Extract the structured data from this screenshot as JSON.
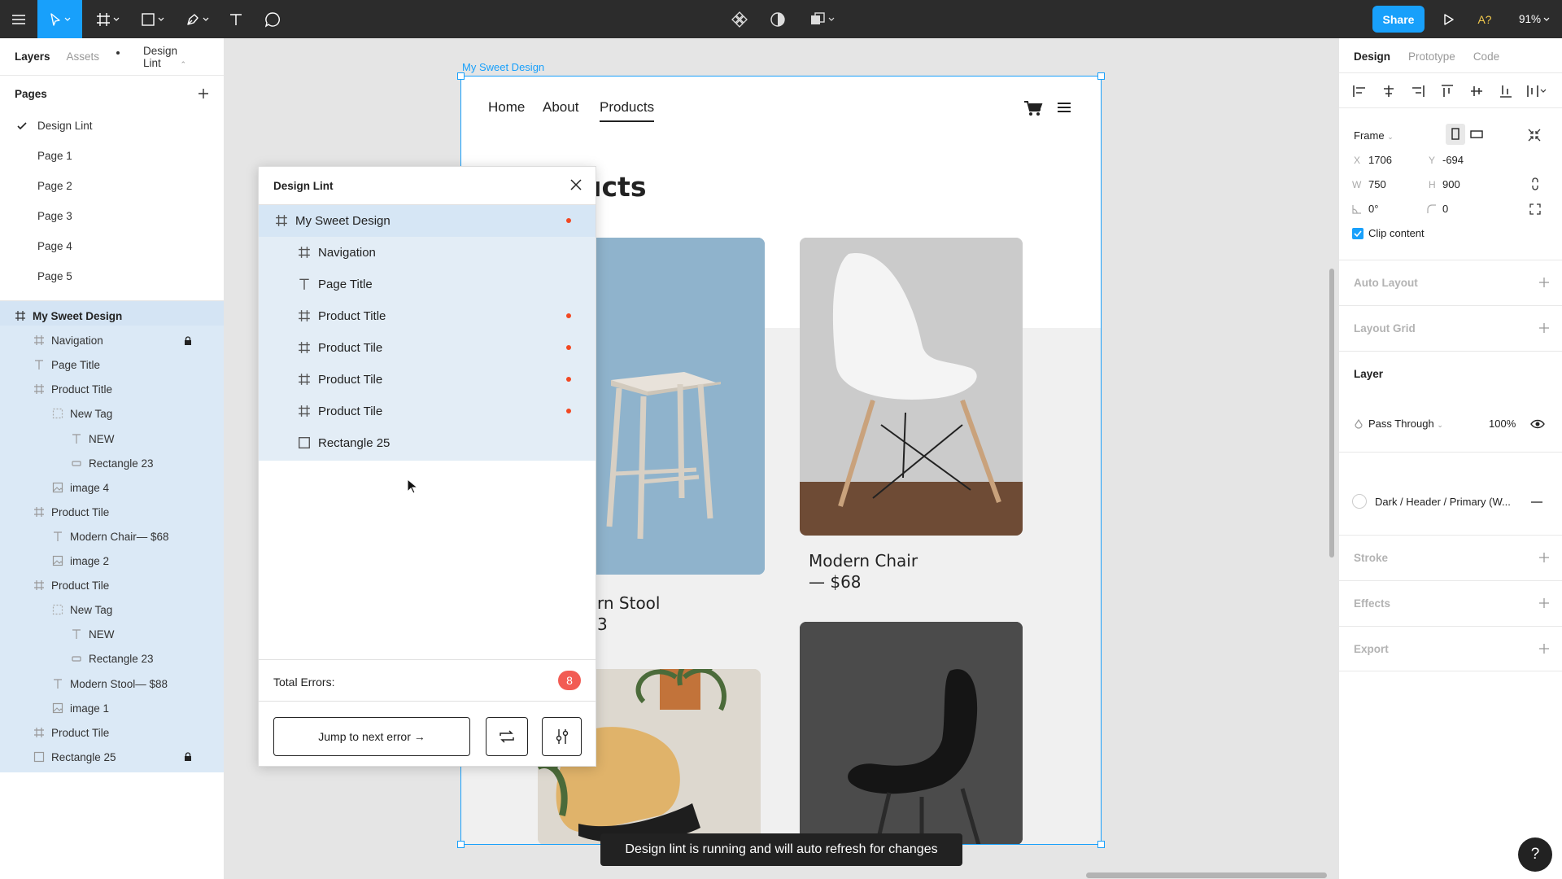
{
  "toolbar": {
    "share_label": "Share",
    "user_initials": "A?",
    "zoom": "91%"
  },
  "left_panel": {
    "tabs": {
      "layers": "Layers",
      "assets": "Assets",
      "plugin": "Design Lint"
    },
    "pages_title": "Pages",
    "pages": [
      "Design Lint",
      "Page 1",
      "Page 2",
      "Page 3",
      "Page 4",
      "Page 5"
    ],
    "layers": [
      {
        "label": "My Sweet Design",
        "icon": "frame-icon",
        "indent": 0
      },
      {
        "label": "Navigation",
        "icon": "frame-icon",
        "indent": 1,
        "locked": true
      },
      {
        "label": "Page Title",
        "icon": "text-icon",
        "indent": 1
      },
      {
        "label": "Product Title",
        "icon": "frame-icon",
        "indent": 1
      },
      {
        "label": "New Tag",
        "icon": "component-dashed-icon",
        "indent": 2
      },
      {
        "label": "NEW",
        "icon": "text-icon",
        "indent": 3
      },
      {
        "label": "Rectangle 23",
        "icon": "rectangle-small-icon",
        "indent": 3
      },
      {
        "label": "image 4",
        "icon": "image-icon",
        "indent": 2
      },
      {
        "label": "Product Tile",
        "icon": "frame-icon",
        "indent": 1
      },
      {
        "label": "Modern Chair— $68",
        "icon": "text-icon",
        "indent": 2
      },
      {
        "label": "image 2",
        "icon": "image-icon",
        "indent": 2
      },
      {
        "label": "Product Tile",
        "icon": "frame-icon",
        "indent": 1
      },
      {
        "label": "New Tag",
        "icon": "component-dashed-icon",
        "indent": 2
      },
      {
        "label": "NEW",
        "icon": "text-icon",
        "indent": 3
      },
      {
        "label": "Rectangle 23",
        "icon": "rectangle-small-icon",
        "indent": 3
      },
      {
        "label": "Modern Stool— $88",
        "icon": "text-icon",
        "indent": 2
      },
      {
        "label": "image 1",
        "icon": "image-icon",
        "indent": 2
      },
      {
        "label": "Product Tile",
        "icon": "frame-icon",
        "indent": 1
      },
      {
        "label": "Rectangle 25",
        "icon": "rectangle-icon",
        "indent": 1,
        "locked": true
      }
    ]
  },
  "canvas": {
    "frame_label": "My Sweet Design",
    "nav": {
      "home": "Home",
      "about": "About",
      "products": "Products"
    },
    "page_title_fragment": "ucts",
    "chair_title": "Modern Chair",
    "chair_price": "— $68",
    "stool_title_fragment": "rn Stool",
    "stool_price_fragment": "3",
    "toast": "Design lint is running and will auto refresh for changes"
  },
  "plugin": {
    "title": "Design Lint",
    "tree": [
      {
        "label": "My Sweet Design",
        "icon": "frame-icon",
        "error": true,
        "selected": true
      },
      {
        "label": "Navigation",
        "icon": "frame-icon",
        "error": false
      },
      {
        "label": "Page Title",
        "icon": "text-icon",
        "error": false
      },
      {
        "label": "Product Title",
        "icon": "frame-icon",
        "error": true
      },
      {
        "label": "Product Tile",
        "icon": "frame-icon",
        "error": true
      },
      {
        "label": "Product Tile",
        "icon": "frame-icon",
        "error": true
      },
      {
        "label": "Product Tile",
        "icon": "frame-icon",
        "error": true
      },
      {
        "label": "Rectangle 25",
        "icon": "rectangle-icon",
        "error": false
      }
    ],
    "total_errors_label": "Total Errors:",
    "total_errors": "8",
    "jump_label": "Jump to next error →"
  },
  "right_panel": {
    "tabs": {
      "design": "Design",
      "prototype": "Prototype",
      "code": "Code"
    },
    "frame_label": "Frame",
    "x_label": "X",
    "x": "1706",
    "y_label": "Y",
    "y": "-694",
    "w_label": "W",
    "w": "750",
    "h_label": "H",
    "h": "900",
    "rotation": "0°",
    "radius": "0",
    "clip_content": "Clip content",
    "auto_layout": "Auto Layout",
    "layout_grid": "Layout Grid",
    "layer_title": "Layer",
    "blend_mode": "Pass Through",
    "opacity": "100%",
    "fill_style": "Dark / Header / Primary (W...",
    "stroke": "Stroke",
    "effects": "Effects",
    "export": "Export"
  },
  "help": "?"
}
